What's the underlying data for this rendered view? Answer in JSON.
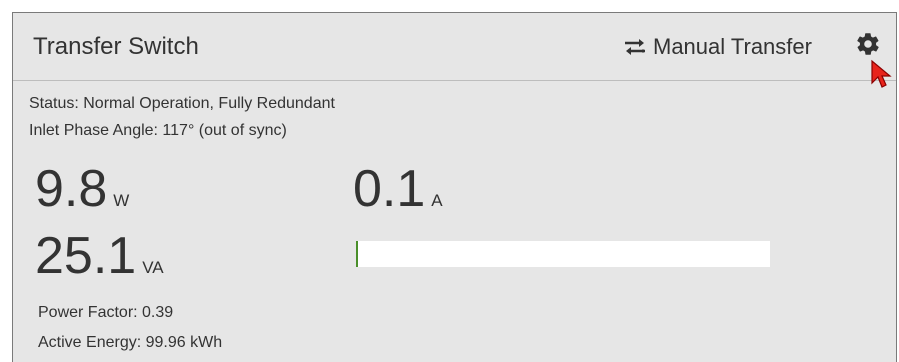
{
  "header": {
    "title": "Transfer Switch",
    "manual_transfer_label": "Manual Transfer",
    "manual_transfer_icon": "swap-arrows-icon",
    "settings_icon": "gear-icon"
  },
  "status": {
    "status_text": "Status: Normal Operation, Fully Redundant",
    "phase_angle_text": "Inlet Phase Angle: 117° (out of sync)"
  },
  "readings": {
    "active_power_value": "9.8",
    "active_power_unit": "W",
    "apparent_power_value": "25.1",
    "apparent_power_unit": "VA",
    "current_value": "0.1",
    "current_unit": "A",
    "current_bar_fraction": 0.005
  },
  "details": {
    "power_factor_text": "Power Factor: 0.39",
    "active_energy_text": "Active Energy: 99.96 kWh"
  },
  "colors": {
    "panel_background": "#e6e6e6",
    "bar_fill": "#4a8f2a",
    "bar_track": "#ffffff",
    "cursor": "#e8231b"
  }
}
